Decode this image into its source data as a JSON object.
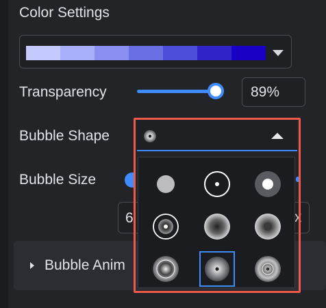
{
  "color_settings": {
    "label": "Color Settings",
    "palette": [
      "#c6cbff",
      "#a9affa",
      "#8a8ff0",
      "#6a6fe4",
      "#4c4dd8",
      "#3023c8",
      "#1a00c4"
    ]
  },
  "transparency": {
    "label": "Transparency",
    "value": "89%",
    "level": 0.89
  },
  "bubble_shape": {
    "label": "Bubble Shape",
    "selected_index": 7,
    "options": [
      {
        "icon": "solid-dot-icon"
      },
      {
        "icon": "ring-with-dot-icon"
      },
      {
        "icon": "dot-in-grey-disc-icon"
      },
      {
        "icon": "double-ring-target-icon"
      },
      {
        "icon": "radial-gradient-sphere-icon"
      },
      {
        "icon": "dark-core-gradient-icon"
      },
      {
        "icon": "haloed-gradient-icon"
      },
      {
        "icon": "glow-dot-gradient-icon"
      },
      {
        "icon": "concentric-gradient-icon"
      }
    ]
  },
  "bubble_size": {
    "label": "Bubble Size",
    "value": "6",
    "suffix": "x"
  },
  "accordion": {
    "label": "Bubble Anim"
  },
  "colors": {
    "accent": "#3f8cff",
    "highlight": "#ef5a4c"
  }
}
